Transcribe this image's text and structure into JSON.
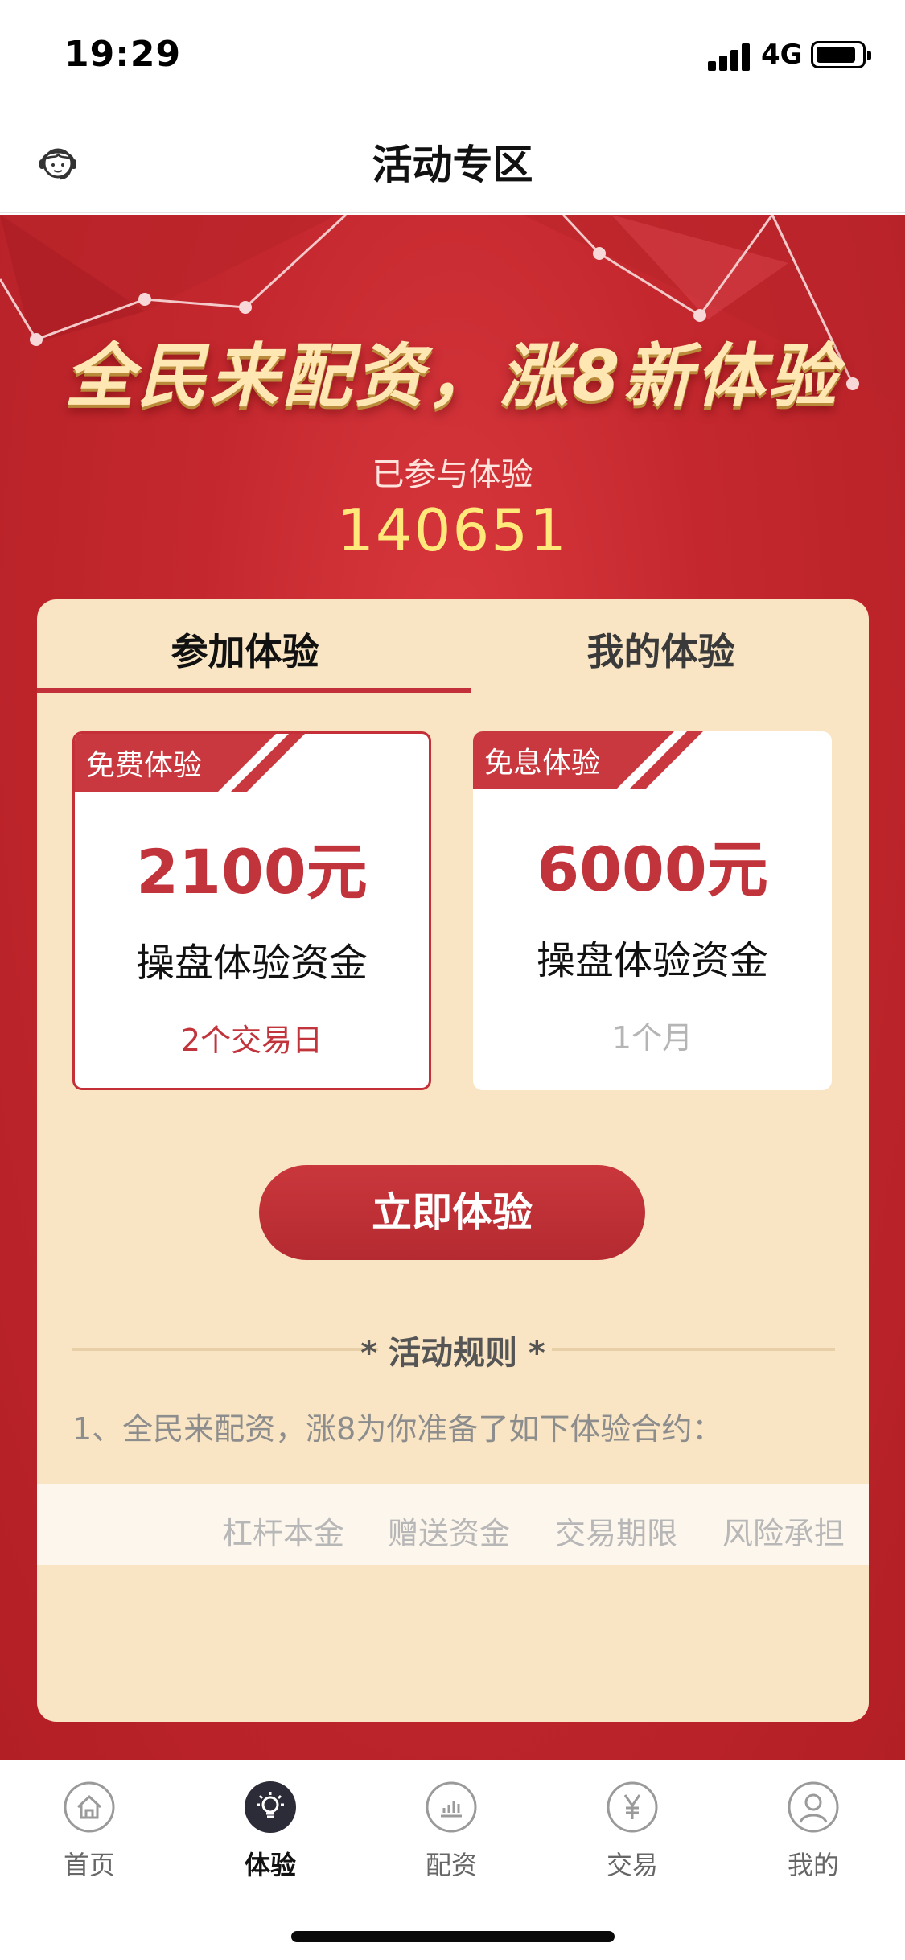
{
  "status_bar": {
    "time": "19:29",
    "network": "4G"
  },
  "nav": {
    "title": "活动专区",
    "left_icon": "customer-service-icon"
  },
  "hero": {
    "banner": "全民来配资，涨8新体验",
    "participants_label": "已参与体验",
    "participants_count": "140651"
  },
  "tabs": [
    {
      "label": "参加体验",
      "active": true
    },
    {
      "label": "我的体验",
      "active": false
    }
  ],
  "offers": [
    {
      "tag": "免费体验",
      "amount": "2100元",
      "subtitle": "操盘体验资金",
      "duration": "2个交易日",
      "selected": true
    },
    {
      "tag": "免息体验",
      "amount": "6000元",
      "subtitle": "操盘体验资金",
      "duration": "1个月",
      "selected": false
    }
  ],
  "cta": {
    "label": "立即体验"
  },
  "rules": {
    "title": "* 活动规则 *",
    "line1": "1、全民来配资，涨8为你准备了如下体验合约：",
    "table_headers": [
      "杠杆本金",
      "赠送资金",
      "交易期限",
      "风险承担"
    ]
  },
  "tabbar": [
    {
      "label": "首页",
      "icon": "home-icon",
      "active": false
    },
    {
      "label": "体验",
      "icon": "lightbulb-icon",
      "active": true
    },
    {
      "label": "配资",
      "icon": "chart-icon",
      "active": false
    },
    {
      "label": "交易",
      "icon": "yen-icon",
      "active": false
    },
    {
      "label": "我的",
      "icon": "user-icon",
      "active": false
    }
  ],
  "colors": {
    "brand_red": "#c2343b",
    "card_bg": "#f9e5c4",
    "highlight_yellow": "#ffe97a"
  }
}
